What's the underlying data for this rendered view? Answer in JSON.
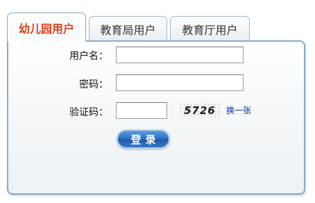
{
  "tabs": [
    {
      "label": "幼儿园用户",
      "active": true
    },
    {
      "label": "教育局用户",
      "active": false
    },
    {
      "label": "教育厅用户",
      "active": false
    }
  ],
  "form": {
    "username_label": "用户名：",
    "username_value": "",
    "password_label": "密码：",
    "password_value": "",
    "captcha_label": "验证码：",
    "captcha_value": "",
    "captcha_text": "5726",
    "refresh_label": "换一张",
    "login_label": "登录"
  },
  "colors": {
    "active_tab_text": "#e0401a",
    "panel_border": "#86acc9",
    "button_blue": "#2a6ec2",
    "link_blue": "#1030a0"
  }
}
